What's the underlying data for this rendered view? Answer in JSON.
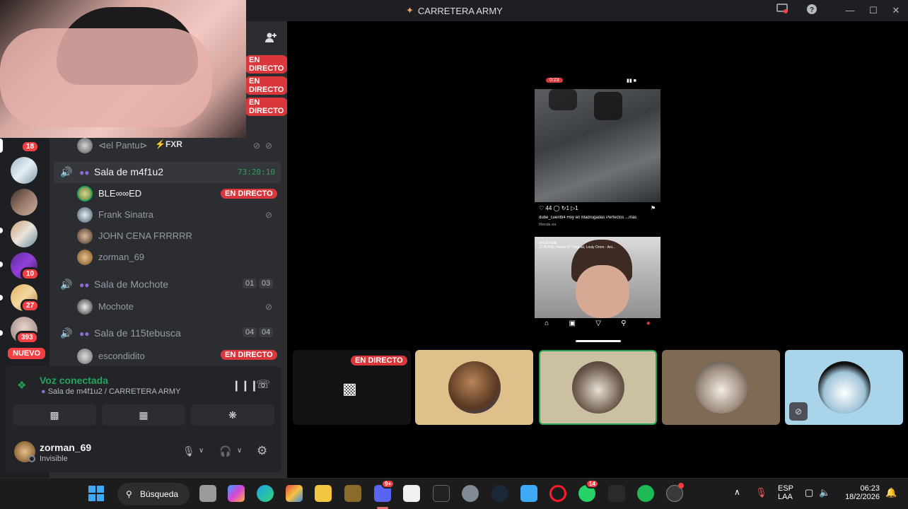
{
  "window": {
    "title": "CARRETERA ARMY"
  },
  "rail": {
    "badges": [
      "18",
      "10",
      "27",
      "393"
    ],
    "new_label": "NUEVO"
  },
  "channels": {
    "live_label": "EN DIRECTO",
    "top_user": {
      "name": "⊲el Pantu⊳",
      "tag": "FXR"
    },
    "rooms": [
      {
        "name": "Sala de m4f1u2",
        "timer": "73:20:10",
        "users": [
          {
            "name": "BLE∞∞ED",
            "live": true
          },
          {
            "name": "Frank Sinatra"
          },
          {
            "name": "JOHN CENA FRRRRR"
          },
          {
            "name": "zorman_69"
          }
        ]
      },
      {
        "name": "Sala de Mochote",
        "count_a": "01",
        "count_b": "03",
        "users": [
          {
            "name": "Mochote"
          }
        ]
      },
      {
        "name": "Sala de 115tebusca",
        "count_a": "04",
        "count_b": "04",
        "users": [
          {
            "name": "escondidito",
            "live": true
          }
        ]
      }
    ]
  },
  "voice": {
    "status": "Voz conectada",
    "location": "Sala de m4f1u2 / CARRETERA ARMY"
  },
  "user": {
    "name": "zorman_69",
    "status": "Invisible"
  },
  "stage": {
    "live_label": "EN DIRECTO",
    "phone": {
      "time": "0:23",
      "likes": "44",
      "reposts": "1",
      "shares": "1",
      "caption": "dube_cuentti4 Hoy en Madrugadas Perfectos ...más",
      "subcaption": "Ilhenda via",
      "post2_user": "petusoloutil",
      "post2_audio": "JT BOND, Remix 67 Original, Louiy Orom - Ani..."
    }
  },
  "taskbar": {
    "search_label": "Búsqueda",
    "discord_badge": "9+",
    "whatsapp_badge": "14",
    "lang": "ESP",
    "layout": "LAA",
    "time": "06:23",
    "date": "18/2/2026"
  },
  "colors": {
    "accent_green": "#23a559",
    "live_red": "#da373c",
    "badge_red": "#f23f43",
    "blurple": "#5865f2"
  }
}
